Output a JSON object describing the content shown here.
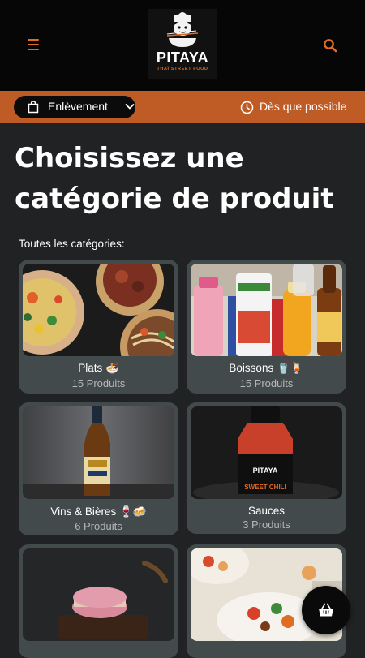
{
  "brand": {
    "name": "PITAYA",
    "tagline": "THAÏ STREET FOOD"
  },
  "order_bar": {
    "mode_label": "Enlèvement",
    "timing_label": "Dès que possible"
  },
  "page_title": "Choisissez une catégorie de produit",
  "section_label": "Toutes les catégories:",
  "categories": [
    {
      "name": "Plats 🍜",
      "count": "15 Produits"
    },
    {
      "name": "Boissons 🥤🍹",
      "count": "15 Produits"
    },
    {
      "name": "Vins & Bières 🍷🍻",
      "count": "6 Produits"
    },
    {
      "name": "Sauces",
      "count": "3 Produits"
    }
  ],
  "colors": {
    "accent": "#e06b22",
    "order_bar": "#bf5b25",
    "card": "#434a4c",
    "background": "#202223"
  },
  "icons": [
    "menu-icon",
    "search-icon",
    "shopping-bag-icon",
    "chevron-down-icon",
    "clock-icon",
    "basket-icon"
  ]
}
